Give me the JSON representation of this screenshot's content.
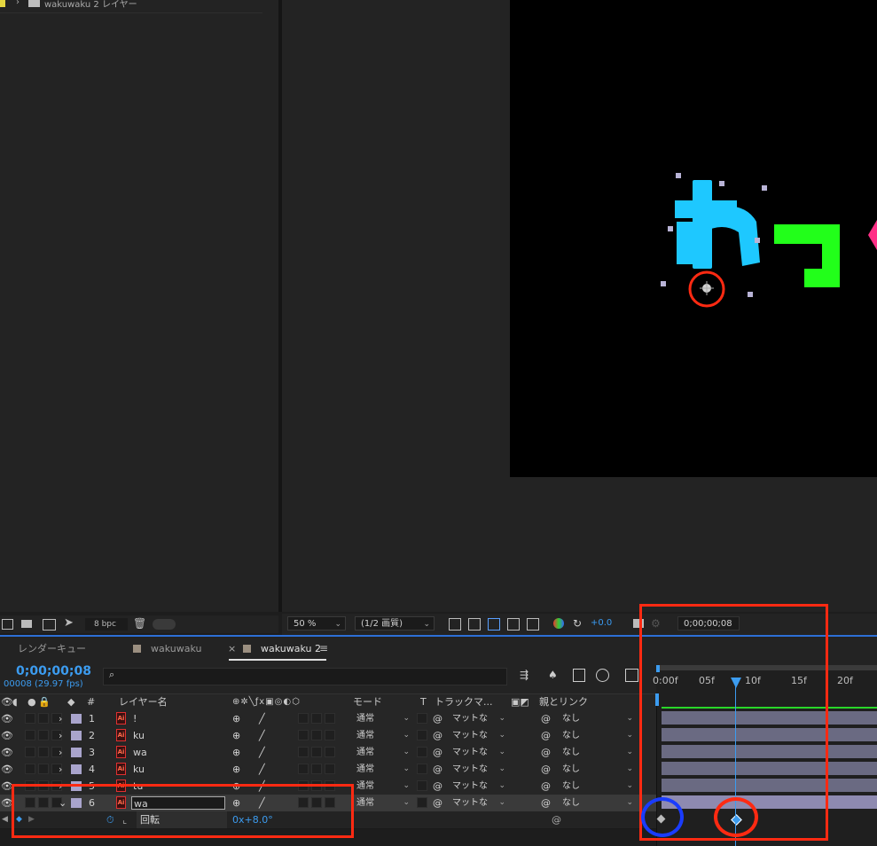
{
  "project": {
    "folder_name": "wakuwaku 2 レイヤー",
    "bpc": "8 bpc"
  },
  "viewer_toolbar": {
    "zoom": "50 %",
    "resolution": "(1/2 画質)",
    "exposure": "+0.0",
    "timecode": "0;00;00;08"
  },
  "tabs": [
    {
      "label": "レンダーキュー"
    },
    {
      "label": "wakuwaku"
    },
    {
      "label": "wakuwaku 2"
    }
  ],
  "timeline": {
    "current_time": "0;00;00;08",
    "frame_info": "00008 (29.97 fps)",
    "search_placeholder": "",
    "ruler_ticks": [
      "0:00f",
      "05f",
      "10f",
      "15f",
      "20f"
    ]
  },
  "columns": {
    "num": "#",
    "layer_name": "レイヤー名",
    "mode": "モード",
    "t": "T",
    "track_matte": "トラックマ...",
    "parent": "親とリンク"
  },
  "layers": [
    {
      "num": "1",
      "name": "!",
      "mode": "通常",
      "matte": "マットな",
      "parent": "なし"
    },
    {
      "num": "2",
      "name": "ku",
      "mode": "通常",
      "matte": "マットな",
      "parent": "なし"
    },
    {
      "num": "3",
      "name": "wa",
      "mode": "通常",
      "matte": "マットな",
      "parent": "なし"
    },
    {
      "num": "4",
      "name": "ku",
      "mode": "通常",
      "matte": "マットな",
      "parent": "なし"
    },
    {
      "num": "5",
      "name": "tu",
      "mode": "通常",
      "matte": "マットな",
      "parent": "なし"
    },
    {
      "num": "6",
      "name": "wa",
      "mode": "通常",
      "matte": "マットな",
      "parent": "なし"
    }
  ],
  "property": {
    "name": "回転",
    "value": "0x+8.0°"
  },
  "colors": {
    "accent": "#2d8ceb",
    "highlight": "#ff2a12",
    "blue_circle": "#1a3cff",
    "layer_label": "#a9a4cc"
  }
}
